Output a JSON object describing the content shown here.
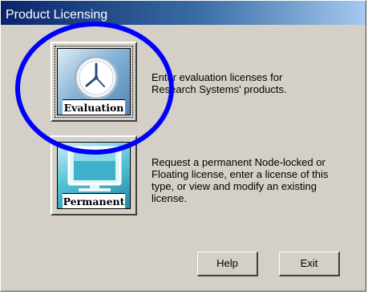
{
  "window": {
    "title": "Product Licensing"
  },
  "evaluation": {
    "button_label": "Evaluation",
    "icon": "clock-icon",
    "description_lines": [
      "Enter evaluation licenses for",
      "Research Systems' products."
    ]
  },
  "permanent": {
    "button_label": "Permanent",
    "icon": "monitor-icon",
    "description_lines": [
      "Request a permanent Node-locked or",
      "Floating license, enter a license of this",
      "type, or view and modify an existing",
      "license."
    ]
  },
  "buttons": {
    "help_label": "Help",
    "exit_label": "Exit"
  },
  "annotation": {
    "shape": "circle",
    "color": "#0000ff"
  }
}
